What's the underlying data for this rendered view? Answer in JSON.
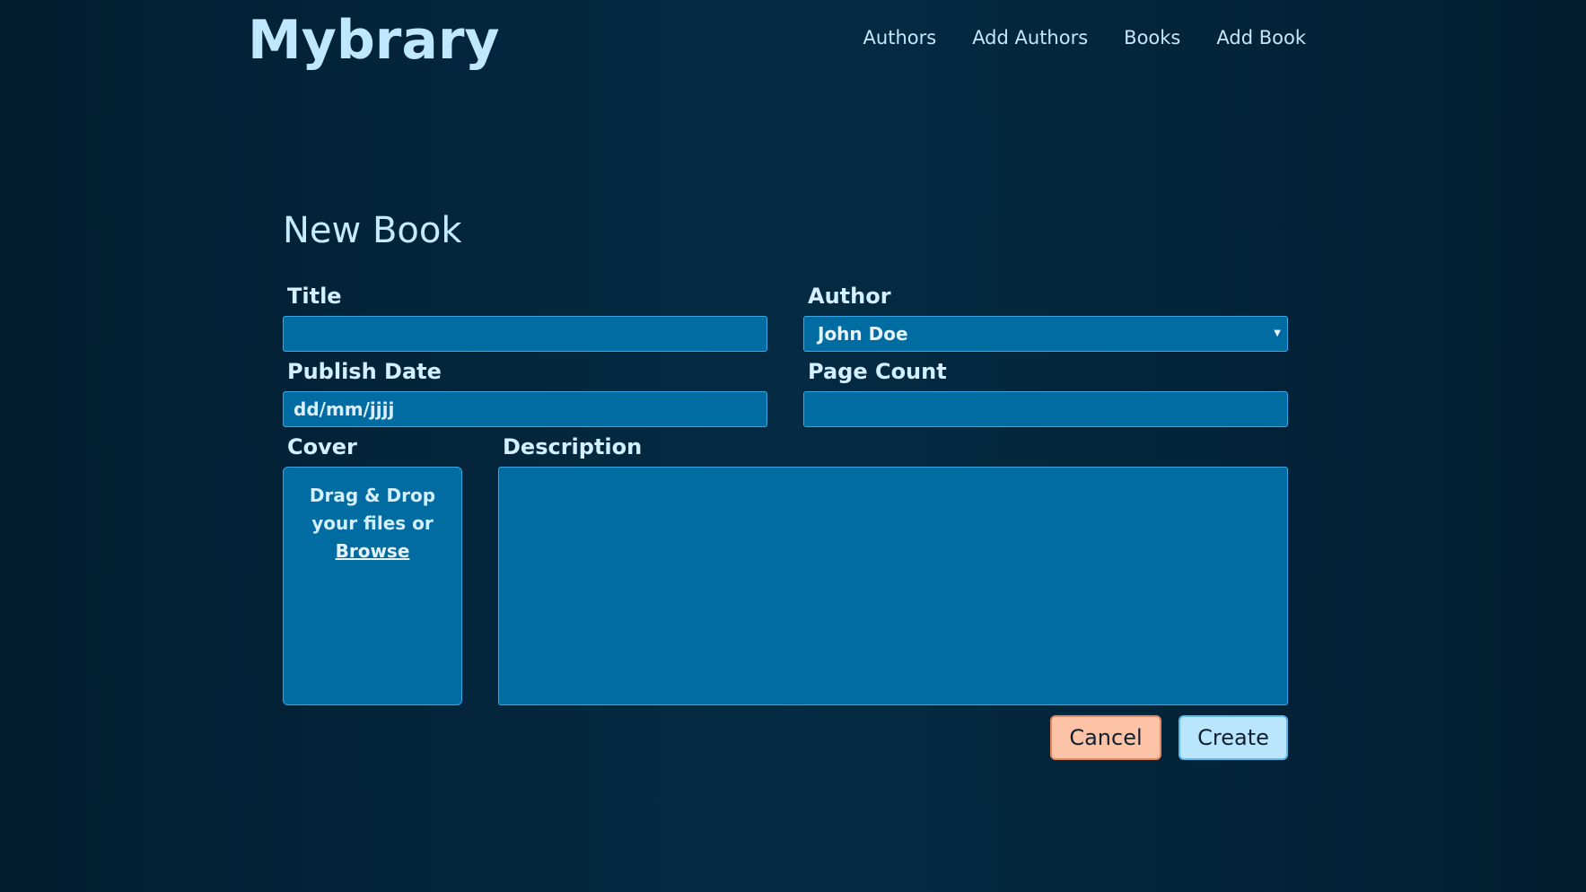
{
  "app": {
    "logo": "Mybrary",
    "nav": [
      "Authors",
      "Add Authors",
      "Books",
      "Add Book"
    ]
  },
  "form": {
    "title": "New Book",
    "fields": {
      "title_label": "Title",
      "title_value": "",
      "author_label": "Author",
      "author_selected": "John Doe",
      "publish_date_label": "Publish Date",
      "publish_date_placeholder": "dd/mm/jjjj",
      "page_count_label": "Page Count",
      "page_count_value": "",
      "cover_label": "Cover",
      "cover_dropzone_text": "Drag & Drop your files or",
      "cover_browse_link": "Browse",
      "description_label": "Description",
      "description_value": ""
    },
    "buttons": {
      "cancel": "Cancel",
      "create": "Create"
    }
  },
  "colors": {
    "background": "#042b43",
    "field_fill": "#016ca1",
    "field_border": "#39a7e3",
    "cancel_button": "#fdc3a6",
    "create_button": "#b9e5fd",
    "text_light": "#c9ecff"
  },
  "icons": {
    "author_select": "caret-down-icon"
  }
}
